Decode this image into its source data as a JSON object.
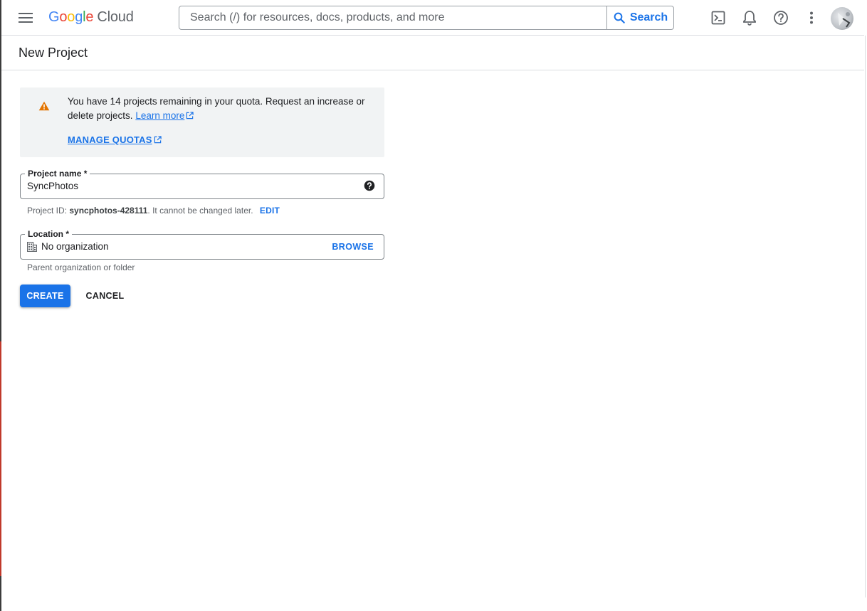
{
  "header": {
    "logo_word": [
      "G",
      "o",
      "o",
      "g",
      "l",
      "e"
    ],
    "logo_suffix": "Cloud",
    "search": {
      "placeholder": "Search (/) for resources, docs, products, and more",
      "button_label": "Search"
    },
    "icons": [
      "terminal-icon",
      "bell-icon",
      "help-icon",
      "more-vert-icon"
    ]
  },
  "page": {
    "title": "New Project"
  },
  "quota_notice": {
    "text": "You have 14 projects remaining in your quota. Request an increase or delete projects.",
    "learn_more": "Learn more",
    "manage_quotas": "MANAGE QUOTAS"
  },
  "project_name": {
    "label": "Project name *",
    "value": "SyncPhotos",
    "hint_prefix": "Project ID: ",
    "project_id": "syncphotos-428111",
    "hint_suffix": ". It cannot be changed later.",
    "edit_label": "EDIT"
  },
  "location": {
    "label": "Location *",
    "value": "No organization",
    "browse_label": "BROWSE",
    "hint": "Parent organization or folder"
  },
  "actions": {
    "create_label": "CREATE",
    "cancel_label": "CANCEL"
  },
  "colors": {
    "accent": "#1a73e8",
    "warning": "#e37400",
    "notice_bg": "#f1f3f4"
  }
}
